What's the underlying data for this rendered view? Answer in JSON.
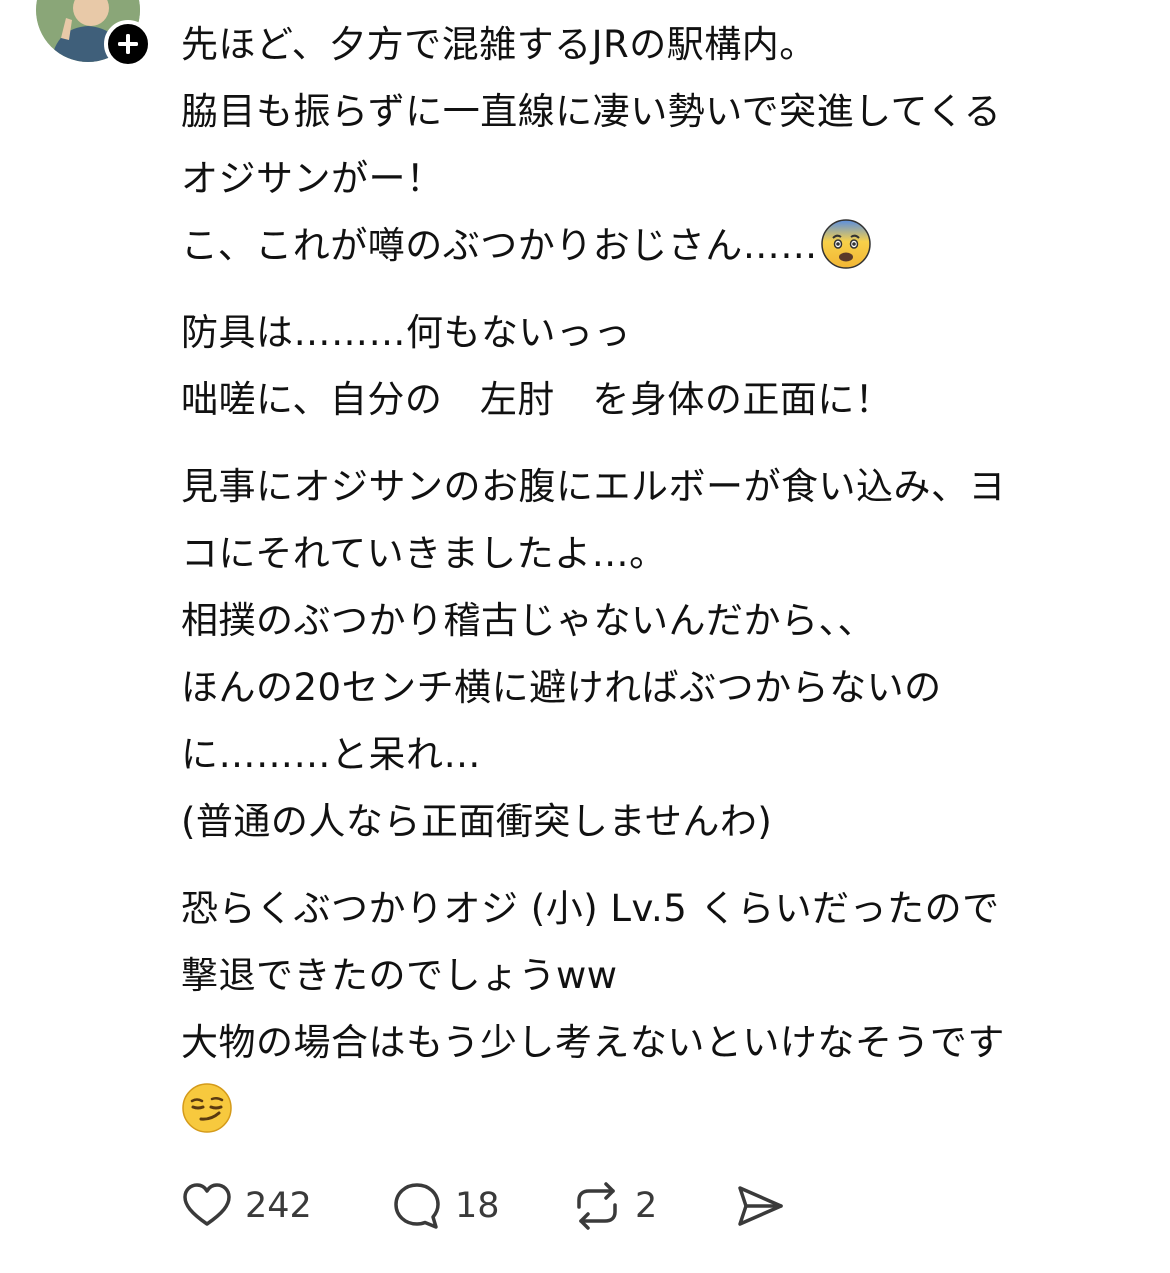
{
  "post": {
    "paragraphs": [
      [
        "先ほど、夕方で混雑するJRの駅構内。",
        "脇目も振らずに一直線に凄い勢いで突進してくる",
        "オジサンがー！",
        "こ、これが噂のぶつかりおじさん……"
      ],
      [
        "防具は………何もないっっ",
        "咄嗟に、自分の　左肘　を身体の正面に！"
      ],
      [
        "見事にオジサンのお腹にエルボーが食い込み、ヨ",
        "コにそれていきましたよ…。",
        "相撲のぶつかり稽古じゃないんだから、、",
        "ほんの20センチ横に避ければぶつからないの",
        "に………と呆れ…",
        "(普通の人なら正面衝突しませんわ)"
      ],
      [
        "恐らくぶつかりオジ (小) Lv.5 くらいだったので",
        "撃退できたのでしょうww",
        "大物の場合はもう少し考えないといけなそうです"
      ]
    ],
    "emoji_fearful": "fearful-face-emoji",
    "emoji_smirk": "smirking-face-emoji"
  },
  "actions": {
    "like_count": "242",
    "reply_count": "18",
    "repost_count": "2",
    "like_icon": "heart-icon",
    "reply_icon": "comment-bubble-icon",
    "repost_icon": "repost-arrows-icon",
    "share_icon": "send-icon"
  }
}
